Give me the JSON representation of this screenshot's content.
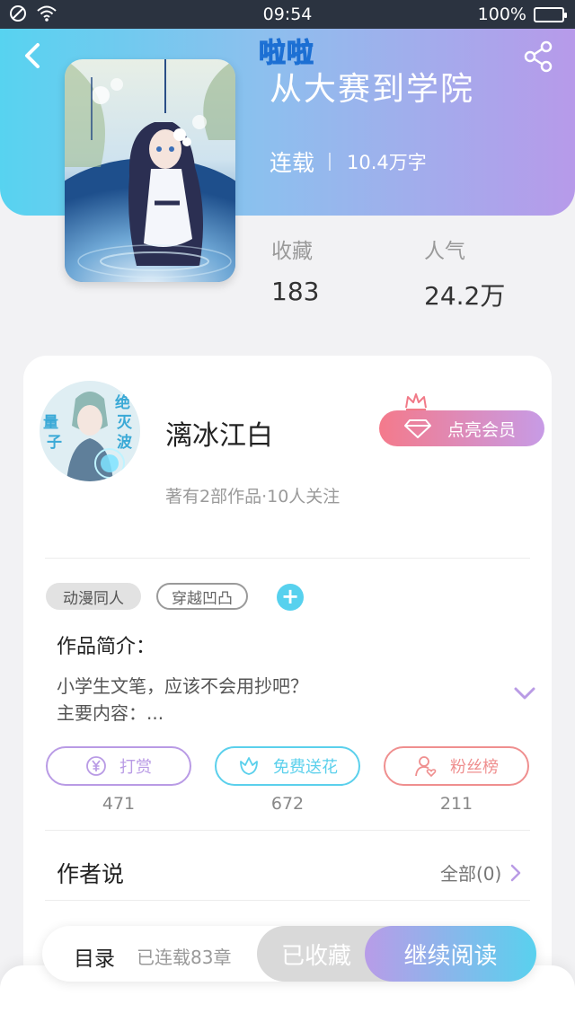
{
  "status_bar": {
    "time": "09:54",
    "battery": "100%",
    "battery_level": 1.0
  },
  "header": {
    "cover_tag": "啦啦",
    "title": "从大赛到学院",
    "status": "连载",
    "word_count": "10.4万字"
  },
  "stats": [
    {
      "label": "收藏",
      "value": "183"
    },
    {
      "label": "人气",
      "value": "24.2万"
    }
  ],
  "author": {
    "name": "漓冰江白",
    "info": "著有2部作品·10人关注",
    "vip_label": "点亮会员",
    "avatar_text": [
      "绝",
      "灭",
      "波",
      "量",
      "子"
    ]
  },
  "tags": [
    "动漫同人",
    "穿越凹凸"
  ],
  "intro": {
    "title": "作品简介：",
    "line1": "小学生文笔，应该不会用抄吧？",
    "line2": "主要内容：..."
  },
  "actions": [
    {
      "label": "打赏",
      "count": "471",
      "color": "#b99be5"
    },
    {
      "label": "免费送花",
      "count": "672",
      "color": "#5bd0ec"
    },
    {
      "label": "粉丝榜",
      "count": "211",
      "color": "#ef8f8f"
    }
  ],
  "author_say": {
    "title": "作者说",
    "see_all": "全部(0)"
  },
  "bottom": {
    "toc": "目录",
    "chapters": "已连载83章",
    "favorited": "已收藏",
    "continue": "继续阅读"
  }
}
